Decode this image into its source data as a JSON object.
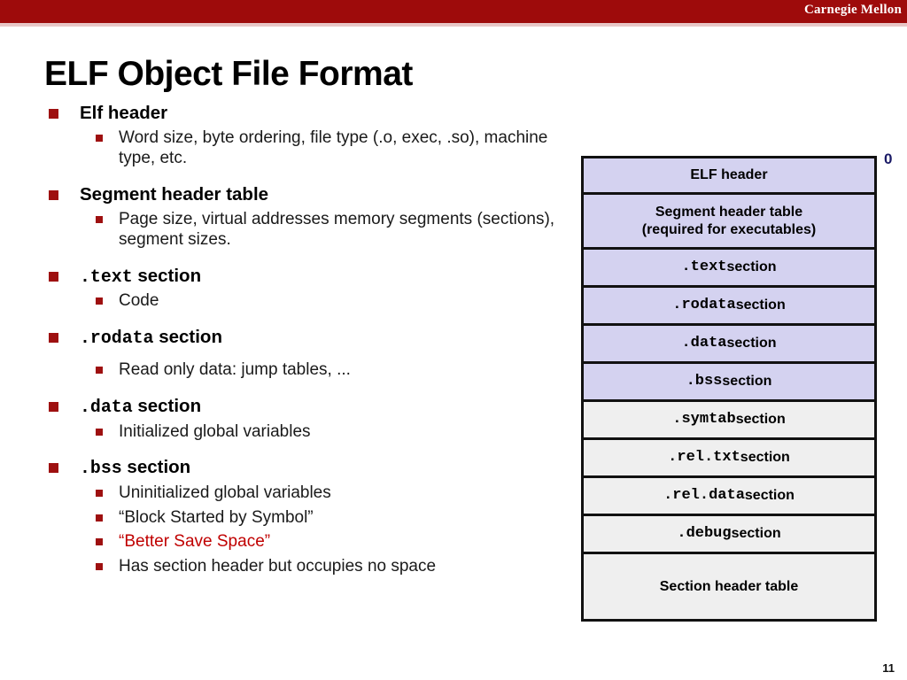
{
  "banner": {
    "brand": "Carnegie Mellon",
    "band_color": "#9E0B0B",
    "underline_color": "#E8C7C7"
  },
  "title": "ELF Object File Format",
  "accent_colors": {
    "bullet_red": "#9E1010",
    "highlight_red": "#C00000",
    "address_navy": "#1A1A66",
    "box_lavender": "#D4D2F0",
    "box_gray": "#EFEFEF",
    "box_border": "#111111"
  },
  "outline": [
    {
      "level": 1,
      "text": "Elf header",
      "mono": "",
      "suffix": ""
    },
    {
      "level": 2,
      "text": "Word size, byte ordering, file type (.o, exec, .so), machine type, etc."
    },
    {
      "level": 1,
      "text": "Segment header table",
      "mono": "",
      "suffix": ""
    },
    {
      "level": 2,
      "text": "Page size, virtual addresses memory segments (sections), segment sizes."
    },
    {
      "level": 1,
      "mono": ".text",
      "suffix": " section"
    },
    {
      "level": 2,
      "text": "Code"
    },
    {
      "level": 1,
      "mono": ".rodata",
      "suffix": " section"
    },
    {
      "level": 2,
      "text": "Read only data: jump tables, ..."
    },
    {
      "level": 1,
      "mono": ".data",
      "suffix": " section"
    },
    {
      "level": 2,
      "text": "Initialized global variables"
    },
    {
      "level": 1,
      "mono": ".bss",
      "suffix": " section"
    },
    {
      "level": 2,
      "text": "Uninitialized global variables"
    },
    {
      "level": 2,
      "text": "“Block Started by Symbol”"
    },
    {
      "level": 2,
      "text": "“Better Save Space”",
      "color": "red"
    },
    {
      "level": 2,
      "text": "Has section header but occupies no space"
    }
  ],
  "outline_flat": {
    "b1_label": "Elf header",
    "b1_sub": "Word size, byte ordering, file type (.o, exec, .so), machine type, etc.",
    "b2_label": "Segment header table",
    "b2_sub": "Page size, virtual addresses memory segments (sections), segment sizes.",
    "b3_mono": ".text",
    "b3_suffix": " section",
    "b3_sub": "Code",
    "b4_mono": ".rodata",
    "b4_suffix": " section",
    "b4_sub": "Read only data: jump tables, ...",
    "b5_mono": ".data",
    "b5_suffix": " section",
    "b5_sub": "Initialized global variables",
    "b6_mono": ".bss",
    "b6_suffix": " section",
    "b6_sub1": "Uninitialized global variables",
    "b6_sub2": "“Block Started by Symbol”",
    "b6_sub3": "“Better Save Space”",
    "b6_sub4": "Has section header but occupies no space"
  },
  "diagram": {
    "address_label": "0",
    "rows": [
      {
        "mono": "",
        "label": "ELF header",
        "fill": "lavender",
        "size": "h-1"
      },
      {
        "mono": "",
        "label": "Segment header table",
        "label2": "(required for executables)",
        "fill": "lavender",
        "size": "h-2"
      },
      {
        "mono": ".text",
        "label": " section",
        "fill": "lavender",
        "size": "h-3"
      },
      {
        "mono": ".rodata",
        "label": " section",
        "fill": "lavender",
        "size": "h-3"
      },
      {
        "mono": ".data",
        "label": " section",
        "fill": "lavender",
        "size": "h-3"
      },
      {
        "mono": ".bss",
        "label": " section",
        "fill": "lavender",
        "size": "h-3"
      },
      {
        "mono": ".symtab",
        "label": " section",
        "fill": "gray",
        "size": "h-3"
      },
      {
        "mono": ".rel.txt",
        "label": " section",
        "fill": "gray",
        "size": "h-3"
      },
      {
        "mono": ".rel.data",
        "label": " section",
        "fill": "gray",
        "size": "h-3"
      },
      {
        "mono": ".debug",
        "label": " section",
        "fill": "gray",
        "size": "h-3"
      },
      {
        "mono": "",
        "label": "Section header table",
        "fill": "gray",
        "size": "h-tall"
      }
    ],
    "flat": {
      "r1": "ELF header",
      "r2a": "Segment header table",
      "r2b": "(required for executables)",
      "r3m": ".text",
      "r3s": " section",
      "r4m": ".rodata",
      "r4s": " section",
      "r5m": ".data",
      "r5s": " section",
      "r6m": ".bss",
      "r6s": " section",
      "r7m": ".symtab",
      "r7s": " section",
      "r8m": ".rel.txt",
      "r8s": " section",
      "r9m": ".rel.data",
      "r9s": " section",
      "r10m": ".debug",
      "r10s": " section",
      "r11": "Section header table"
    }
  },
  "slide_number": "11"
}
